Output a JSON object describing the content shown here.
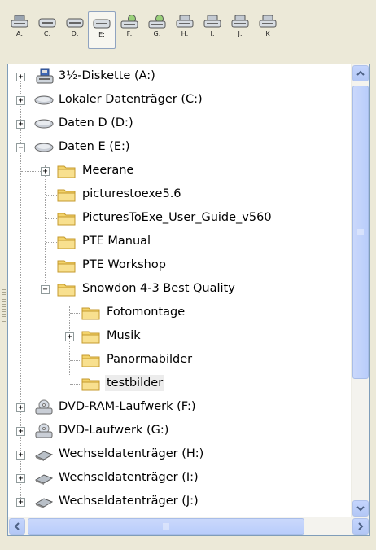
{
  "drives": [
    {
      "label": "A:",
      "icon": "floppy-drive-icon"
    },
    {
      "label": "C:",
      "icon": "hard-drive-icon"
    },
    {
      "label": "D:",
      "icon": "hard-drive-icon"
    },
    {
      "label": "E:",
      "icon": "hard-drive-icon",
      "selected": true
    },
    {
      "label": "F:",
      "icon": "dvd-drive-icon"
    },
    {
      "label": "G:",
      "icon": "dvd-drive-icon"
    },
    {
      "label": "H:",
      "icon": "removable-drive-icon"
    },
    {
      "label": "I:",
      "icon": "removable-drive-icon"
    },
    {
      "label": "J:",
      "icon": "removable-drive-icon"
    },
    {
      "label": "K",
      "icon": "removable-drive-icon"
    }
  ],
  "tree": {
    "items": [
      {
        "label": "3½-Diskette (A:)",
        "icon": "floppy-drive-icon",
        "expander": "+"
      },
      {
        "label": "Lokaler Datenträger (C:)",
        "icon": "hard-drive-icon",
        "expander": "+"
      },
      {
        "label": "Daten D (D:)",
        "icon": "hard-drive-icon",
        "expander": "+"
      },
      {
        "label": "Daten E (E:)",
        "icon": "hard-drive-icon",
        "expander": "−"
      },
      {
        "label": "Meerane",
        "icon": "folder-icon",
        "expander": "+"
      },
      {
        "label": "picturestoexe5.6",
        "icon": "folder-icon"
      },
      {
        "label": "PicturesToExe_User_Guide_v560",
        "icon": "folder-icon"
      },
      {
        "label": "PTE Manual",
        "icon": "folder-icon"
      },
      {
        "label": "PTE Workshop",
        "icon": "folder-icon"
      },
      {
        "label": "Snowdon 4-3 Best Quality",
        "icon": "folder-icon",
        "expander": "−"
      },
      {
        "label": "Fotomontage",
        "icon": "folder-icon"
      },
      {
        "label": "Musik",
        "icon": "folder-icon",
        "expander": "+"
      },
      {
        "label": "Panormabilder",
        "icon": "folder-icon"
      },
      {
        "label": "testbilder",
        "icon": "folder-icon",
        "selected": true
      },
      {
        "label": "DVD-RAM-Laufwerk (F:)",
        "icon": "dvd-drive-icon",
        "expander": "+"
      },
      {
        "label": "DVD-Laufwerk (G:)",
        "icon": "dvd-drive-icon",
        "expander": "+"
      },
      {
        "label": "Wechseldatenträger (H:)",
        "icon": "removable-drive-icon",
        "expander": "+"
      },
      {
        "label": "Wechseldatenträger (I:)",
        "icon": "removable-drive-icon",
        "expander": "+"
      },
      {
        "label": "Wechseldatenträger (J:)",
        "icon": "removable-drive-icon",
        "expander": "+"
      }
    ]
  },
  "colors": {
    "folder": "#f3d36b",
    "selection": "#ececec",
    "scrollbar": "#c1d3fb",
    "border": "#7f9db9"
  }
}
